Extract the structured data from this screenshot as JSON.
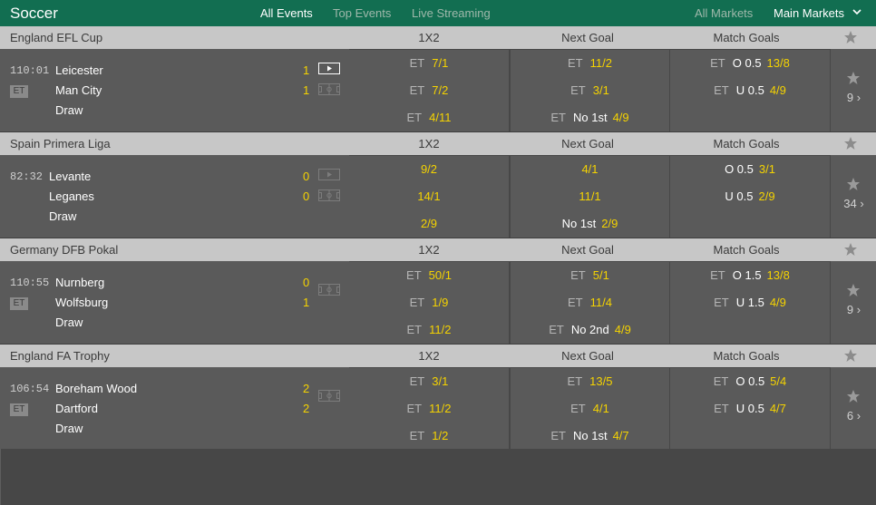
{
  "header": {
    "title": "Soccer",
    "nav": [
      "All Events",
      "Top Events",
      "Live Streaming"
    ],
    "all_markets": "All Markets",
    "main_markets": "Main Markets"
  },
  "columns": [
    "1X2",
    "Next Goal",
    "Match Goals"
  ],
  "events": [
    {
      "competition": "England EFL Cup",
      "clock": "110:01",
      "et_badge": "ET",
      "home": "Leicester",
      "away": "Man City",
      "draw": "Draw",
      "home_score": "1",
      "away_score": "1",
      "streaming": true,
      "more_count": "9 ›",
      "markets": {
        "x12": [
          {
            "et": "ET",
            "odd": "7/1"
          },
          {
            "et": "ET",
            "odd": "7/2"
          },
          {
            "et": "ET",
            "odd": "4/11"
          }
        ],
        "next_goal": [
          {
            "et": "ET",
            "label": "",
            "odd": "11/2"
          },
          {
            "et": "ET",
            "label": "",
            "odd": "3/1"
          },
          {
            "et": "ET",
            "label": "No 1st",
            "odd": "4/9"
          }
        ],
        "match_goals": [
          {
            "et": "ET",
            "label": "O 0.5",
            "odd": "13/8"
          },
          {
            "et": "ET",
            "label": "U 0.5",
            "odd": "4/9"
          }
        ]
      }
    },
    {
      "competition": "Spain Primera Liga",
      "clock": "82:32",
      "et_badge": "",
      "home": "Levante",
      "away": "Leganes",
      "draw": "Draw",
      "home_score": "0",
      "away_score": "0",
      "streaming": false,
      "more_count": "34 ›",
      "markets": {
        "x12": [
          {
            "et": "",
            "odd": "9/2"
          },
          {
            "et": "",
            "odd": "14/1"
          },
          {
            "et": "",
            "odd": "2/9"
          }
        ],
        "next_goal": [
          {
            "et": "",
            "label": "",
            "odd": "4/1"
          },
          {
            "et": "",
            "label": "",
            "odd": "11/1"
          },
          {
            "et": "",
            "label": "No 1st",
            "odd": "2/9"
          }
        ],
        "match_goals": [
          {
            "et": "",
            "label": "O 0.5",
            "odd": "3/1"
          },
          {
            "et": "",
            "label": "U 0.5",
            "odd": "2/9"
          }
        ]
      }
    },
    {
      "competition": "Germany DFB Pokal",
      "clock": "110:55",
      "et_badge": "ET",
      "home": "Nurnberg",
      "away": "Wolfsburg",
      "draw": "Draw",
      "home_score": "0",
      "away_score": "1",
      "streaming": false,
      "more_count": "9 ›",
      "markets": {
        "x12": [
          {
            "et": "ET",
            "odd": "50/1"
          },
          {
            "et": "ET",
            "odd": "1/9"
          },
          {
            "et": "ET",
            "odd": "11/2"
          }
        ],
        "next_goal": [
          {
            "et": "ET",
            "label": "",
            "odd": "5/1"
          },
          {
            "et": "ET",
            "label": "",
            "odd": "11/4"
          },
          {
            "et": "ET",
            "label": "No 2nd",
            "odd": "4/9"
          }
        ],
        "match_goals": [
          {
            "et": "ET",
            "label": "O 1.5",
            "odd": "13/8"
          },
          {
            "et": "ET",
            "label": "U 1.5",
            "odd": "4/9"
          }
        ]
      }
    },
    {
      "competition": "England FA Trophy",
      "clock": "106:54",
      "et_badge": "ET",
      "home": "Boreham Wood",
      "away": "Dartford",
      "draw": "Draw",
      "home_score": "2",
      "away_score": "2",
      "streaming": false,
      "more_count": "6 ›",
      "markets": {
        "x12": [
          {
            "et": "ET",
            "odd": "3/1"
          },
          {
            "et": "ET",
            "odd": "11/2"
          },
          {
            "et": "ET",
            "odd": "1/2"
          }
        ],
        "next_goal": [
          {
            "et": "ET",
            "label": "",
            "odd": "13/5"
          },
          {
            "et": "ET",
            "label": "",
            "odd": "4/1"
          },
          {
            "et": "ET",
            "label": "No 1st",
            "odd": "4/7"
          }
        ],
        "match_goals": [
          {
            "et": "ET",
            "label": "O 0.5",
            "odd": "5/4"
          },
          {
            "et": "ET",
            "label": "U 0.5",
            "odd": "4/7"
          }
        ]
      }
    }
  ],
  "colors": {
    "header_green": "#126e51",
    "odds_yellow": "#f5d300",
    "competition_bar": "#c7c7c7"
  }
}
